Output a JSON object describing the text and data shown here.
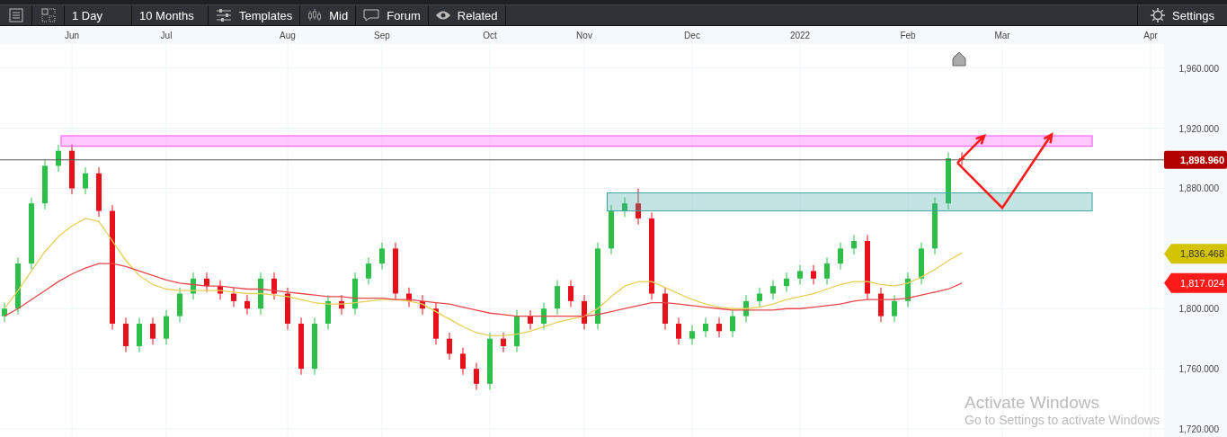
{
  "toolbar": {
    "items": [
      {
        "kind": "icon"
      },
      {
        "kind": "icon"
      },
      {
        "kind": "text",
        "label": "1 Day"
      },
      {
        "kind": "text",
        "label": "10 Months"
      },
      {
        "kind": "icon-text",
        "label": "Templates"
      },
      {
        "kind": "icon-text",
        "label": "Mid"
      },
      {
        "kind": "icon-text",
        "label": "Forum"
      },
      {
        "kind": "icon-text",
        "label": "Related"
      }
    ],
    "settings": {
      "label": "Settings"
    }
  },
  "chart": {
    "chart_data": {
      "type": "candlestick",
      "ylim": [
        1714,
        1976
      ],
      "grid": true,
      "categories": [
        null,
        null,
        null,
        null,
        null,
        "Jun",
        null,
        null,
        null,
        null,
        null,
        null,
        "Jul",
        null,
        null,
        null,
        null,
        null,
        null,
        null,
        null,
        "Aug",
        null,
        null,
        null,
        null,
        null,
        null,
        "Sep",
        null,
        null,
        null,
        null,
        null,
        null,
        null,
        "Oct",
        null,
        null,
        null,
        null,
        null,
        null,
        "Nov",
        null,
        null,
        null,
        null,
        null,
        null,
        null,
        "Dec",
        null,
        null,
        null,
        null,
        null,
        null,
        null,
        "2022",
        null,
        null,
        null,
        null,
        null,
        null,
        null,
        "Feb",
        null,
        null,
        null,
        null,
        null,
        null,
        "Mar",
        null,
        null,
        null,
        null,
        null,
        null,
        null,
        null,
        null,
        null,
        "Apr",
        null
      ],
      "yticks": [
        {
          "value": 1960,
          "label": "1,960.000"
        },
        {
          "value": 1920,
          "label": "1,920.000"
        },
        {
          "value": 1880,
          "label": "1,880.000"
        },
        {
          "value": 1800,
          "label": "1,800.000"
        },
        {
          "value": 1760,
          "label": "1,760.000"
        },
        {
          "value": 1720,
          "label": "1,720.000"
        },
        {
          "value": 1898.96,
          "label": "1,898.960"
        },
        {
          "value": 1836.468,
          "label": "1,836.468"
        },
        {
          "value": 1817.024,
          "label": "1,817.024"
        }
      ],
      "ohlc": [
        [
          1795,
          1804,
          1791,
          1800
        ],
        [
          1800,
          1834,
          1796,
          1830
        ],
        [
          1830,
          1874,
          1826,
          1870
        ],
        [
          1870,
          1899,
          1866,
          1895
        ],
        [
          1895,
          1909,
          1891,
          1905
        ],
        [
          1905,
          1909,
          1876,
          1880
        ],
        [
          1880,
          1894,
          1876,
          1890
        ],
        [
          1890,
          1894,
          1861,
          1865
        ],
        [
          1865,
          1869,
          1786,
          1790
        ],
        [
          1790,
          1794,
          1771,
          1775
        ],
        [
          1775,
          1794,
          1771,
          1790
        ],
        [
          1790,
          1794,
          1776,
          1780
        ],
        [
          1780,
          1799,
          1776,
          1795
        ],
        [
          1795,
          1814,
          1791,
          1810
        ],
        [
          1810,
          1824,
          1806,
          1820
        ],
        [
          1820,
          1824,
          1811,
          1815
        ],
        [
          1815,
          1819,
          1806,
          1810
        ],
        [
          1810,
          1814,
          1801,
          1805
        ],
        [
          1805,
          1809,
          1796,
          1800
        ],
        [
          1800,
          1824,
          1796,
          1820
        ],
        [
          1820,
          1824,
          1806,
          1810
        ],
        [
          1810,
          1814,
          1786,
          1790
        ],
        [
          1790,
          1794,
          1756,
          1760
        ],
        [
          1760,
          1794,
          1756,
          1790
        ],
        [
          1790,
          1809,
          1786,
          1805
        ],
        [
          1805,
          1809,
          1796,
          1800
        ],
        [
          1800,
          1824,
          1796,
          1820
        ],
        [
          1820,
          1834,
          1816,
          1830
        ],
        [
          1830,
          1844,
          1826,
          1840
        ],
        [
          1840,
          1844,
          1806,
          1810
        ],
        [
          1810,
          1814,
          1801,
          1805
        ],
        [
          1805,
          1809,
          1796,
          1800
        ],
        [
          1800,
          1804,
          1776,
          1780
        ],
        [
          1780,
          1784,
          1766,
          1770
        ],
        [
          1770,
          1774,
          1756,
          1760
        ],
        [
          1760,
          1764,
          1746,
          1750
        ],
        [
          1750,
          1784,
          1746,
          1780
        ],
        [
          1780,
          1784,
          1771,
          1775
        ],
        [
          1775,
          1799,
          1771,
          1795
        ],
        [
          1795,
          1799,
          1786,
          1790
        ],
        [
          1790,
          1804,
          1786,
          1800
        ],
        [
          1800,
          1819,
          1796,
          1815
        ],
        [
          1815,
          1819,
          1801,
          1805
        ],
        [
          1805,
          1809,
          1786,
          1790
        ],
        [
          1790,
          1844,
          1786,
          1840
        ],
        [
          1840,
          1869,
          1836,
          1865
        ],
        [
          1865,
          1874,
          1861,
          1870
        ],
        [
          1870,
          1880,
          1856,
          1860
        ],
        [
          1860,
          1864,
          1806,
          1810
        ],
        [
          1810,
          1814,
          1786,
          1790
        ],
        [
          1790,
          1794,
          1776,
          1780
        ],
        [
          1780,
          1789,
          1776,
          1785
        ],
        [
          1785,
          1794,
          1781,
          1790
        ],
        [
          1790,
          1794,
          1781,
          1785
        ],
        [
          1785,
          1799,
          1781,
          1795
        ],
        [
          1795,
          1809,
          1791,
          1805
        ],
        [
          1805,
          1814,
          1801,
          1810
        ],
        [
          1810,
          1819,
          1806,
          1815
        ],
        [
          1815,
          1824,
          1811,
          1820
        ],
        [
          1820,
          1829,
          1816,
          1825
        ],
        [
          1825,
          1829,
          1816,
          1820
        ],
        [
          1820,
          1834,
          1816,
          1830
        ],
        [
          1830,
          1844,
          1826,
          1840
        ],
        [
          1840,
          1849,
          1836,
          1845
        ],
        [
          1845,
          1849,
          1806,
          1810
        ],
        [
          1810,
          1814,
          1791,
          1795
        ],
        [
          1795,
          1809,
          1791,
          1805
        ],
        [
          1805,
          1824,
          1801,
          1820
        ],
        [
          1820,
          1844,
          1816,
          1840
        ],
        [
          1840,
          1874,
          1836,
          1870
        ],
        [
          1870,
          1904,
          1866,
          1900
        ],
        [
          1900,
          1904,
          1895,
          1899
        ],
        null,
        null,
        null,
        null,
        null,
        null,
        null,
        null,
        null,
        null,
        null,
        null,
        null,
        null,
        null
      ],
      "series": [
        {
          "type": "line",
          "color": "#e8cf5a",
          "values": [
            1800,
            1812,
            1825,
            1838,
            1848,
            1855,
            1860,
            1858,
            1845,
            1832,
            1822,
            1816,
            1813,
            1812,
            1812,
            1812,
            1812,
            1811,
            1810,
            1810,
            1809,
            1808,
            1806,
            1804,
            1803,
            1803,
            1804,
            1805,
            1806,
            1806,
            1805,
            1803,
            1798,
            1793,
            1788,
            1784,
            1782,
            1782,
            1783,
            1785,
            1788,
            1791,
            1793,
            1795,
            1800,
            1808,
            1815,
            1818,
            1818,
            1814,
            1810,
            1806,
            1803,
            1801,
            1800,
            1800,
            1801,
            1803,
            1806,
            1808,
            1810,
            1813,
            1816,
            1818,
            1818,
            1816,
            1815,
            1817,
            1821,
            1826,
            1832,
            1837,
            null,
            null,
            null,
            null,
            null,
            null,
            null,
            null,
            null,
            null,
            null,
            null,
            null,
            null,
            null
          ]
        },
        {
          "type": "line",
          "color": "#e8474c",
          "values": [
            1795,
            1800,
            1806,
            1812,
            1818,
            1823,
            1827,
            1830,
            1830,
            1828,
            1825,
            1822,
            1819,
            1817,
            1816,
            1815,
            1815,
            1814,
            1813,
            1813,
            1812,
            1811,
            1810,
            1809,
            1808,
            1808,
            1807,
            1807,
            1807,
            1806,
            1806,
            1805,
            1804,
            1803,
            1801,
            1799,
            1797,
            1796,
            1795,
            1795,
            1795,
            1795,
            1795,
            1795,
            1796,
            1798,
            1800,
            1802,
            1804,
            1804,
            1803,
            1802,
            1801,
            1800,
            1799,
            1799,
            1799,
            1799,
            1800,
            1800,
            1801,
            1802,
            1803,
            1805,
            1806,
            1806,
            1806,
            1807,
            1809,
            1811,
            1813,
            1817,
            null,
            null,
            null,
            null,
            null,
            null,
            null,
            null,
            null,
            null,
            null,
            null,
            null,
            null,
            null
          ]
        }
      ]
    },
    "price_tags": [
      {
        "color": "#b30000"
      },
      {
        "color": "#d4c400"
      },
      {
        "color": "#ff1a1a"
      }
    ]
  },
  "os_overlay": {
    "title": "Activate Windows",
    "subtitle": "Go to Settings to activate Windows"
  }
}
